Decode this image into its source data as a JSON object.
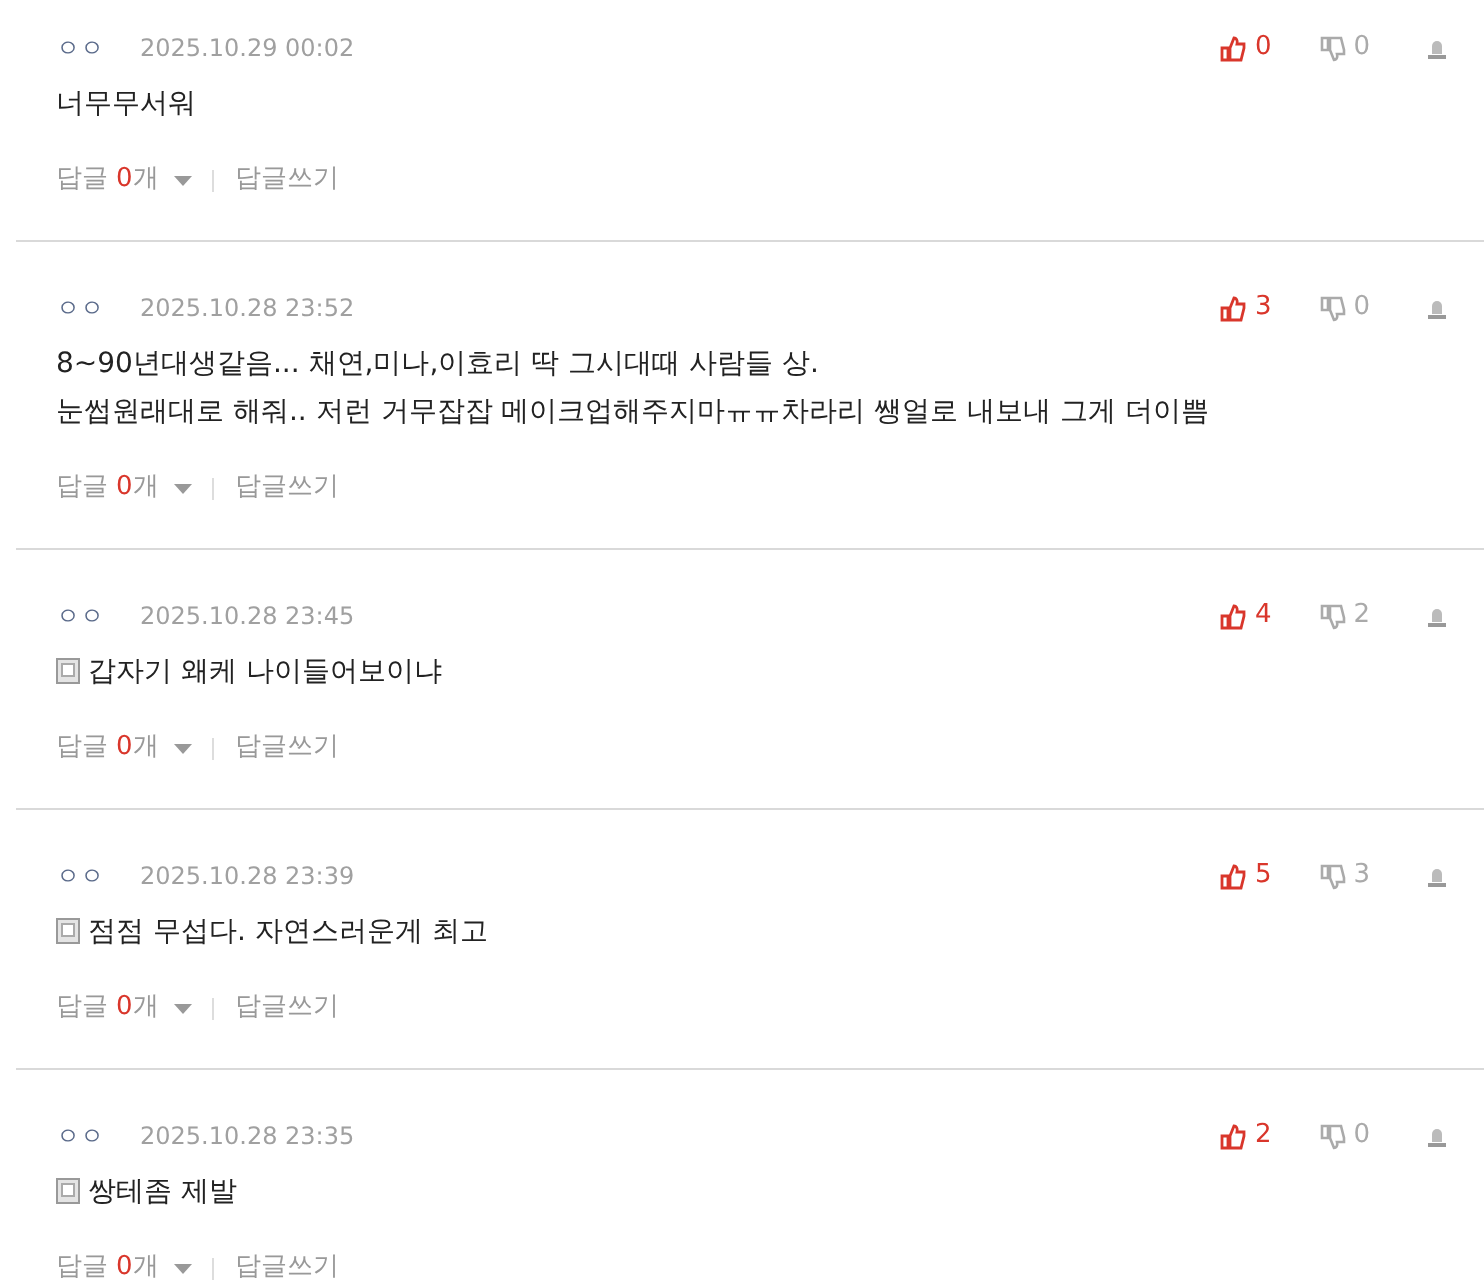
{
  "comments": [
    {
      "author": "ㅇㅇ",
      "date": "2025.10.29 00:02",
      "memo_icon": false,
      "lines": [
        "너무무서워"
      ],
      "likes": "0",
      "dislikes": "0",
      "reply_label": "답글",
      "reply_count": "0",
      "reply_unit": "개",
      "write_reply": "답글쓰기"
    },
    {
      "author": "ㅇㅇ",
      "date": "2025.10.28 23:52",
      "memo_icon": false,
      "lines": [
        "8~90년대생같음... 채연,미나,이효리 딱 그시대때 사람들 상.",
        "눈썹원래대로 해줘.. 저런 거무잡잡 메이크업해주지마ㅠㅠ차라리 쌩얼로 내보내 그게 더이쁨"
      ],
      "likes": "3",
      "dislikes": "0",
      "reply_label": "답글",
      "reply_count": "0",
      "reply_unit": "개",
      "write_reply": "답글쓰기"
    },
    {
      "author": "ㅇㅇ",
      "date": "2025.10.28 23:45",
      "memo_icon": true,
      "lines": [
        "갑자기 왜케 나이들어보이냐"
      ],
      "likes": "4",
      "dislikes": "2",
      "reply_label": "답글",
      "reply_count": "0",
      "reply_unit": "개",
      "write_reply": "답글쓰기"
    },
    {
      "author": "ㅇㅇ",
      "date": "2025.10.28 23:39",
      "memo_icon": true,
      "lines": [
        "점점 무섭다. 자연스러운게 최고"
      ],
      "likes": "5",
      "dislikes": "3",
      "reply_label": "답글",
      "reply_count": "0",
      "reply_unit": "개",
      "write_reply": "답글쓰기"
    },
    {
      "author": "ㅇㅇ",
      "date": "2025.10.28 23:35",
      "memo_icon": true,
      "lines": [
        "쌍테좀 제발"
      ],
      "likes": "2",
      "dislikes": "0",
      "reply_label": "답글",
      "reply_count": "0",
      "reply_unit": "개",
      "write_reply": "답글쓰기"
    }
  ]
}
